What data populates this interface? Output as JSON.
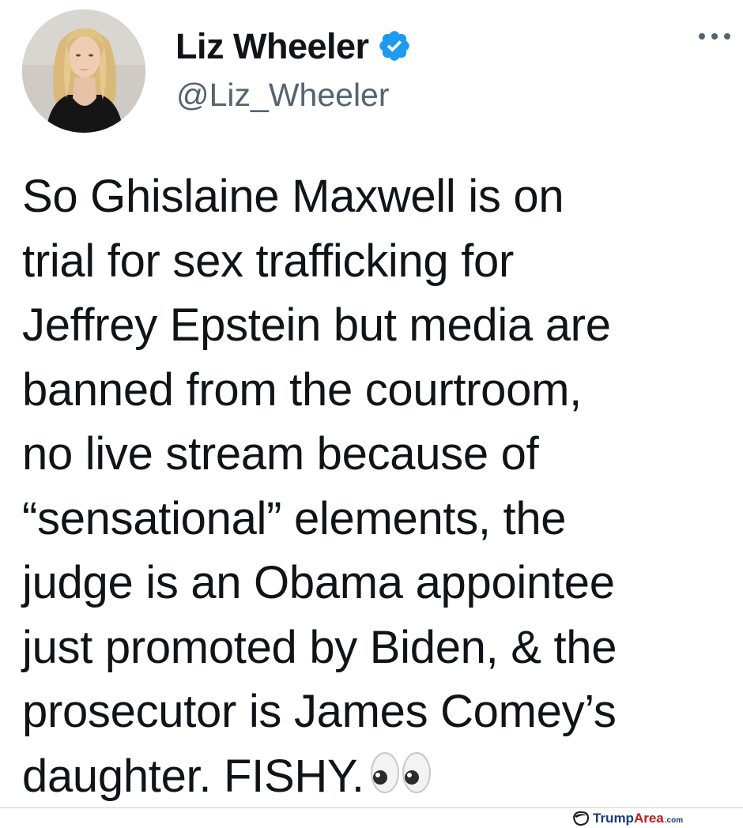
{
  "tweet": {
    "author": {
      "display_name": "Liz Wheeler",
      "handle": "@Liz_Wheeler",
      "verified": true,
      "avatar_icon": "profile-photo"
    },
    "more_icon": "more-horizontal-icon",
    "text": "So Ghislaine Maxwell is on\ntrial for sex trafficking for\nJeffrey Epstein but media are\nbanned from the courtroom,\nno live stream because of\n“sensational” elements, the\njudge is an Obama appointee\njust promoted by Biden, & the\nprosecutor is James Comey’s\ndaughter. FISHY.",
    "emoji": "eyes-emoji"
  },
  "watermark": {
    "brand_part1": "Trump",
    "brand_part2": "Area",
    "suffix": ".com"
  },
  "colors": {
    "verified_blue": "#1d9bf0",
    "handle_gray": "#536471",
    "text": "#0f1419"
  }
}
